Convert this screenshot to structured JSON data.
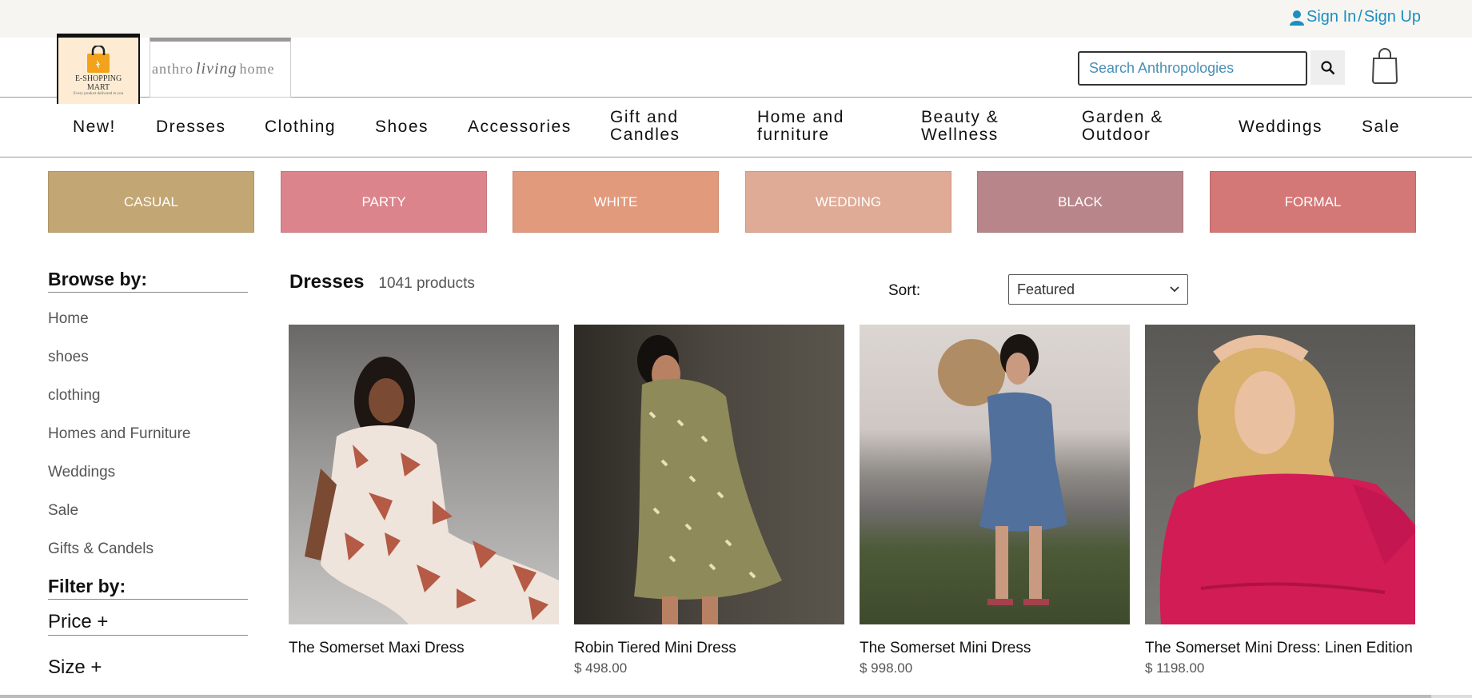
{
  "topbar": {
    "signin": "Sign In",
    "sep": "/",
    "signup": "Sign Up"
  },
  "logos": {
    "brand_line1": "E-SHOPPING",
    "brand_line2": "MART",
    "brand_tagline": "Every product delivered to you",
    "partner_a": "anthro",
    "partner_b": "living",
    "partner_c": "home"
  },
  "search": {
    "placeholder": "Search Anthropologies"
  },
  "nav": [
    "New!",
    "Dresses",
    "Clothing",
    "Shoes",
    "Accessories",
    "Gift and\nCandles",
    "Home and\nfurniture",
    "Beauty &\nWellness",
    "Garden &\nOutdoor",
    "Weddings",
    "Sale"
  ],
  "categories": [
    {
      "label": "CASUAL",
      "color": "#c2a674"
    },
    {
      "label": "PARTY",
      "color": "#dc848c"
    },
    {
      "label": "WHITE",
      "color": "#e29a7c"
    },
    {
      "label": "WEDDING",
      "color": "#dfab96"
    },
    {
      "label": "BLACK",
      "color": "#b8858a"
    },
    {
      "label": "FORMAL",
      "color": "#d47777"
    }
  ],
  "sidebar": {
    "browse_title": "Browse by:",
    "links": [
      "Home",
      "shoes",
      "clothing",
      "Homes and Furniture",
      "Weddings",
      "Sale",
      "Gifts & Candels"
    ],
    "filter_title": "Filter by:",
    "price": "Price +",
    "size": "Size +"
  },
  "main": {
    "title": "Dresses",
    "count": "1041 products",
    "sort_label": "Sort:",
    "sort_value": "Featured"
  },
  "products": [
    {
      "name": "The Somerset Maxi Dress",
      "price": ""
    },
    {
      "name": "Robin Tiered Mini Dress",
      "price": "$ 498.00"
    },
    {
      "name": "The Somerset Mini Dress",
      "price": "$ 998.00"
    },
    {
      "name": "The Somerset Mini Dress: Linen Edition",
      "price": "$ 1198.00"
    }
  ],
  "colors": {
    "accent": "#1a8fc1"
  }
}
